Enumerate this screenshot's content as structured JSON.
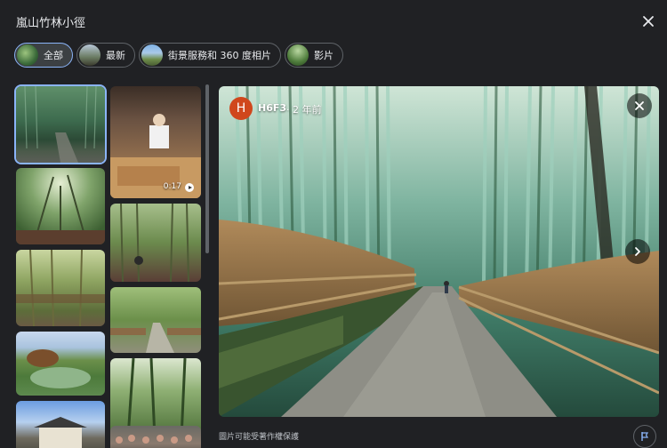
{
  "header": {
    "title": "嵐山竹林小徑"
  },
  "tabs": [
    {
      "label": "全部",
      "active": true
    },
    {
      "label": "最新",
      "active": false
    },
    {
      "label": "街景服務和 360 度相片",
      "active": false
    },
    {
      "label": "影片",
      "active": false
    }
  ],
  "photos": [
    {
      "description": "bamboo-path",
      "selected": true
    },
    {
      "description": "chef-video",
      "duration": "0:17"
    },
    {
      "description": "bamboo-canopy"
    },
    {
      "description": "bamboo-forest"
    },
    {
      "description": "bamboo-grove-light"
    },
    {
      "description": "bamboo-path-fence"
    },
    {
      "description": "garden"
    },
    {
      "description": "bamboo-tall"
    },
    {
      "description": "temple"
    },
    {
      "description": "crowd"
    }
  ],
  "viewer": {
    "author_initial": "H",
    "author": "H6F3",
    "time": "· 2 年前",
    "avatar_color": "#d0471c"
  },
  "footer": {
    "copyright": "圖片可能受著作權保護"
  },
  "colors": {
    "background": "#202124",
    "accent": "#8ab4f8"
  },
  "icons": {
    "close": "close-icon",
    "next": "chevron-right-icon",
    "report": "flag-icon",
    "play": "play-icon"
  }
}
